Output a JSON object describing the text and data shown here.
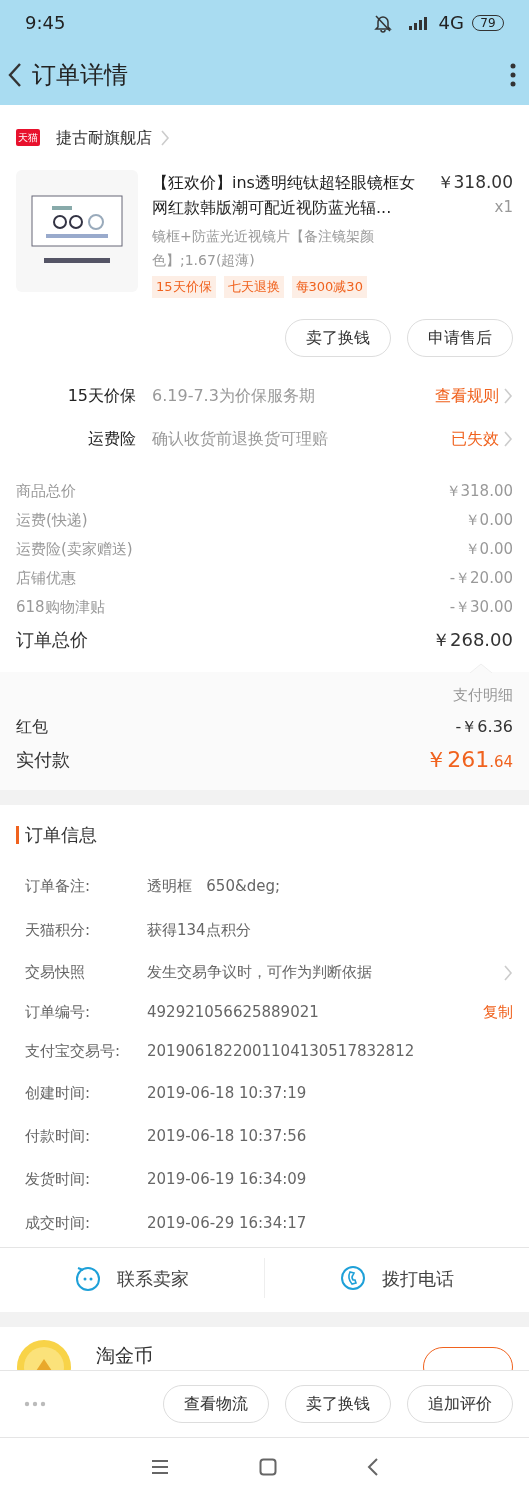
{
  "status_bar": {
    "time": "9:45",
    "network": "4G",
    "battery": "79"
  },
  "header": {
    "title": "订单详情"
  },
  "store": {
    "badge": "天猫",
    "name": "捷古耐旗舰店"
  },
  "product": {
    "title": "【狂欢价】ins透明纯钛超轻眼镜框女网红款韩版潮可配近视防蓝光辐...",
    "price": "￥318.00",
    "quantity": "x1",
    "spec": "镜框+防蓝光近视镜片【备注镜架颜色】;1.67(超薄)",
    "tags": [
      "15天价保",
      "七天退换",
      "每300减30"
    ]
  },
  "product_actions": [
    "卖了换钱",
    "申请售后"
  ],
  "services": [
    {
      "label": "15天价保",
      "description": "6.19-7.3为价保服务期",
      "link": "查看规则"
    },
    {
      "label": "运费险",
      "description": "确认收货前退换货可理赔",
      "link": "已失效"
    }
  ],
  "price_rows": [
    {
      "kind": "line",
      "label": "商品总价",
      "value": "￥318.00"
    },
    {
      "kind": "line",
      "label": "运费(快递)",
      "value": "￥0.00"
    },
    {
      "kind": "line",
      "label": "运费险(卖家赠送)",
      "value": "￥0.00"
    },
    {
      "kind": "line",
      "label": "店铺优惠",
      "value": "-￥20.00"
    },
    {
      "kind": "line",
      "label": "618购物津贴",
      "value": "-￥30.00"
    },
    {
      "kind": "total",
      "label": "订单总价",
      "value": "￥268.00"
    }
  ],
  "payment": {
    "detail_link": "支付明细",
    "rows": [
      {
        "label": "红包",
        "value": "-￥6.36"
      }
    ],
    "paid": {
      "label": "实付款",
      "integer": "￥261",
      "fraction": ".64"
    }
  },
  "order_info": {
    "title": "订单信息",
    "rows": [
      {
        "kind": "text",
        "label": "订单备注:",
        "value": "透明框   650&deg;"
      },
      {
        "kind": "text",
        "label": "天猫积分:",
        "value": "获得134点积分"
      },
      {
        "kind": "link",
        "label": "交易快照",
        "value": "发生交易争议时，可作为判断依据"
      },
      {
        "kind": "copy",
        "label": "订单编号:",
        "value": "492921056625889021",
        "action": "复制"
      },
      {
        "kind": "text",
        "label": "支付宝交易号:",
        "value": "2019061822001104130517832812"
      },
      {
        "kind": "text",
        "label": "创建时间:",
        "value": "2019-06-18 10:37:19"
      },
      {
        "kind": "text",
        "label": "付款时间:",
        "value": "2019-06-18 10:37:56"
      },
      {
        "kind": "text",
        "label": "发货时间:",
        "value": "2019-06-19 16:34:09"
      },
      {
        "kind": "text",
        "label": "成交时间:",
        "value": "2019-06-29 16:34:17"
      }
    ]
  },
  "contact": [
    {
      "kind": "chat",
      "label": "联系卖家"
    },
    {
      "kind": "phone",
      "label": "拨打电话"
    }
  ],
  "coin": {
    "title": "淘金币"
  },
  "bottom_actions": [
    "查看物流",
    "卖了换钱",
    "追加评价"
  ]
}
